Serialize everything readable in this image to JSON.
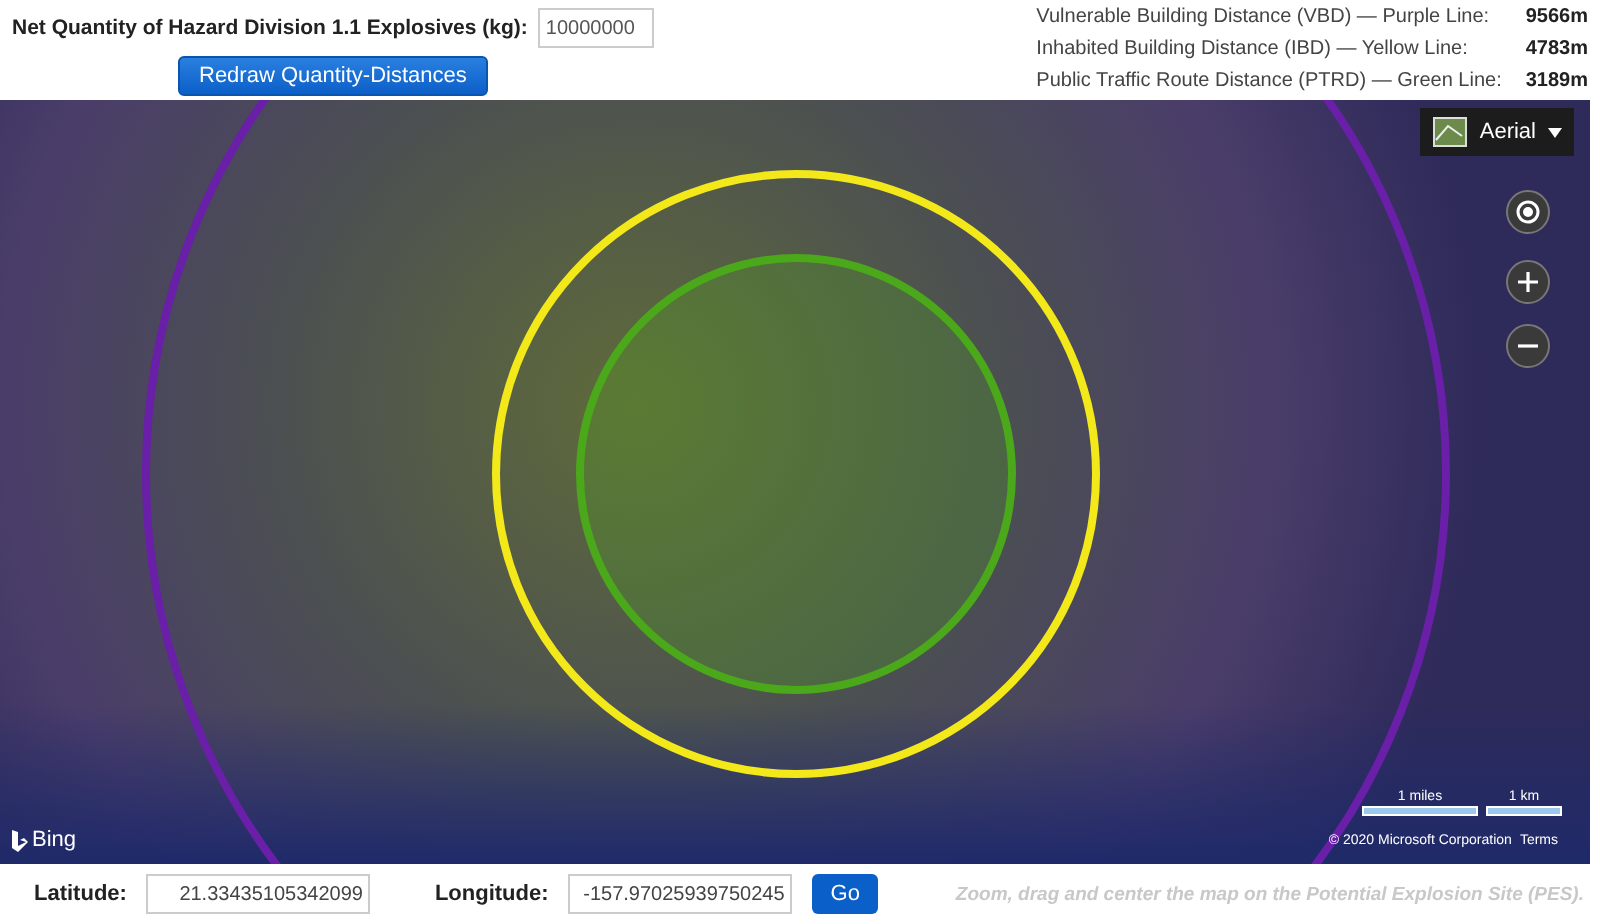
{
  "quantity": {
    "label": "Net Quantity of Hazard Division 1.1 Explosives (kg):",
    "value": "10000000",
    "button": "Redraw Quantity-Distances"
  },
  "distances": [
    {
      "label": "Vulnerable Building Distance (VBD) — Purple Line:",
      "value": "9566m",
      "color": "#6a1fa8"
    },
    {
      "label": "Inhabited Building Distance (IBD) — Yellow Line:",
      "value": "4783m",
      "color": "#f2e81a"
    },
    {
      "label": "Public Traffic Route Distance (PTRD) — Green Line:",
      "value": "3189m",
      "color": "#4aa81a"
    }
  ],
  "map": {
    "layer": "Aerial",
    "brand": "Bing",
    "scale_labels": [
      "1 miles",
      "1 km"
    ],
    "copyright": "© 2020 Microsoft Corporation",
    "terms": "Terms"
  },
  "location": {
    "lat_label": "Latitude:",
    "lat": "21.33435105342099",
    "lon_label": "Longitude:",
    "lon": "-157.97025939750245",
    "go": "Go",
    "hint": "Zoom, drag and center the map on the Potential Explosion Site (PES)."
  }
}
